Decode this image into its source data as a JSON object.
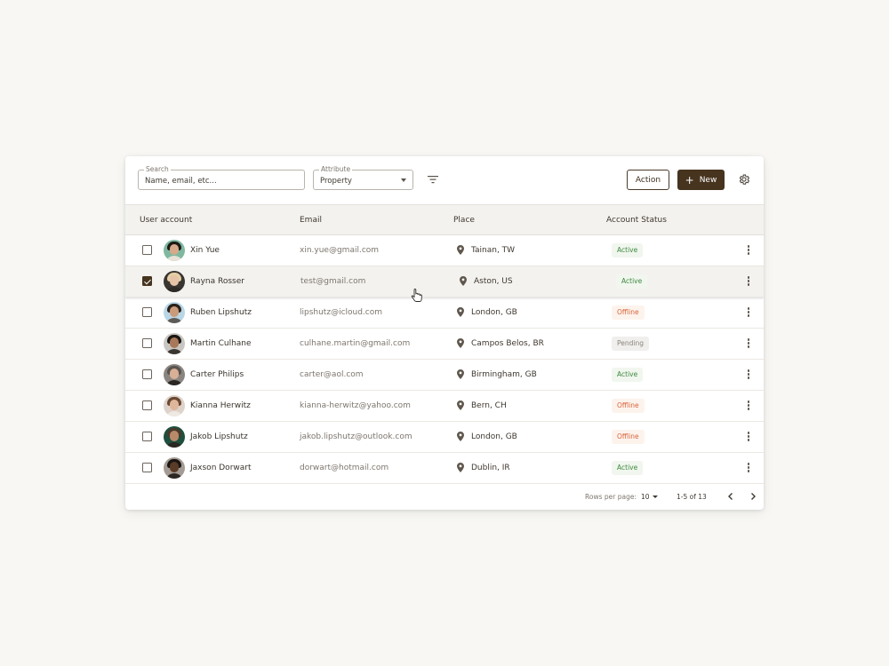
{
  "toolbar": {
    "search": {
      "label": "Search",
      "placeholder": "Name, email, etc..."
    },
    "attribute": {
      "label": "Attribute",
      "value": "Property"
    },
    "filter_icon": "filter-icon",
    "action_label": "Action",
    "new_label": "New",
    "settings_icon": "gear-icon"
  },
  "table": {
    "columns": [
      "User account",
      "Email",
      "Place",
      "Account Status"
    ],
    "rows": [
      {
        "name": "Xin Yue",
        "email": "xin.yue@gmail.com",
        "place": "Tainan, TW",
        "status": "Active",
        "checked": false
      },
      {
        "name": "Rayna Rosser",
        "email": "test@gmail.com",
        "place": "Aston, US",
        "status": "Active",
        "checked": true
      },
      {
        "name": "Ruben Lipshutz",
        "email": "lipshutz@icloud.com",
        "place": "London, GB",
        "status": "Offline",
        "checked": false
      },
      {
        "name": "Martin Culhane",
        "email": "culhane.martin@gmail.com",
        "place": "Campos Belos, BR",
        "status": "Pending",
        "checked": false
      },
      {
        "name": "Carter Philips",
        "email": "carter@aol.com",
        "place": "Birmingham, GB",
        "status": "Active",
        "checked": false
      },
      {
        "name": "Kianna Herwitz",
        "email": "kianna-herwitz@yahoo.com",
        "place": "Bern, CH",
        "status": "Offline",
        "checked": false
      },
      {
        "name": "Jakob Lipshutz",
        "email": "jakob.lipshutz@outlook.com",
        "place": "London, GB",
        "status": "Offline",
        "checked": false
      },
      {
        "name": "Jaxson Dorwart",
        "email": "dorwart@hotmail.com",
        "place": "Dublin, IR",
        "status": "Active",
        "checked": false
      }
    ]
  },
  "pagination": {
    "rows_per_page_label": "Rows per page:",
    "rows_per_page": "10",
    "range": "1-5 of 13"
  },
  "colors": {
    "primary": "#47341f",
    "active": "#3d8a3d",
    "offline": "#d9643a",
    "pending": "#8a847c"
  }
}
